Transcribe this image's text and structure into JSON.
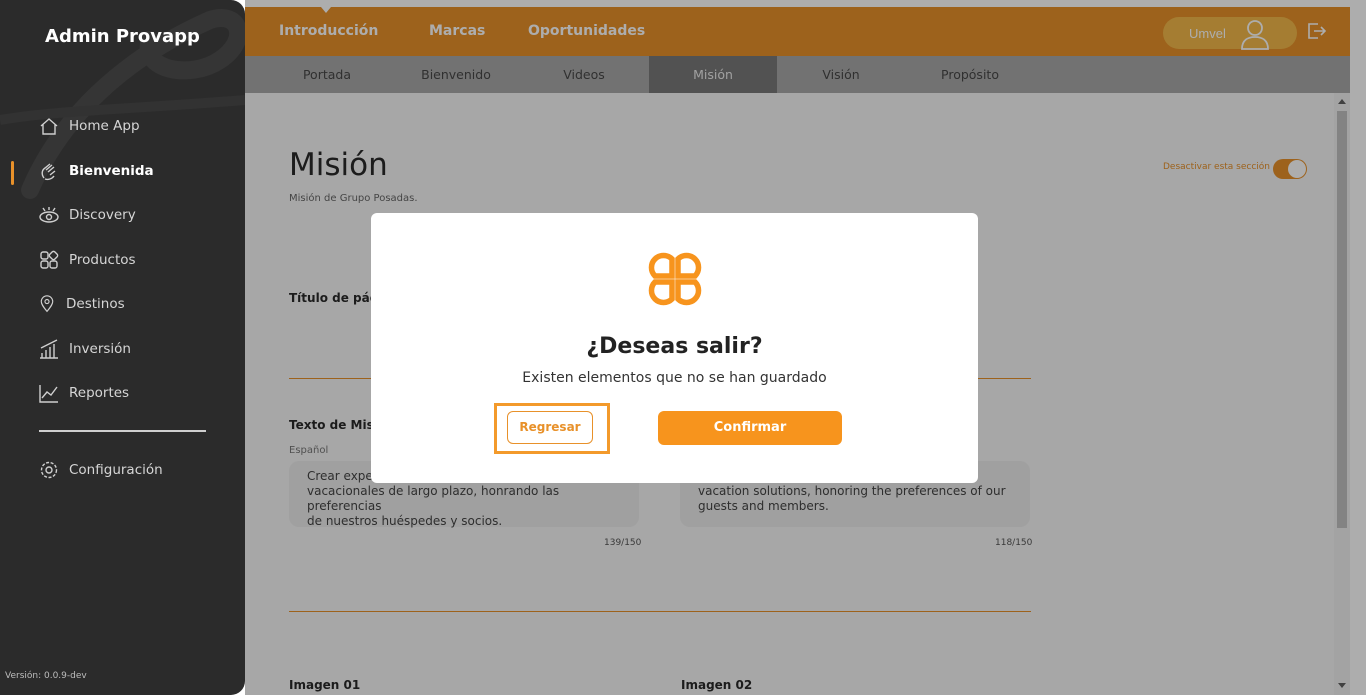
{
  "sidebar": {
    "brand": "Admin Provapp",
    "items": [
      {
        "label": "Home App",
        "icon": "home-icon"
      },
      {
        "label": "Bienvenida",
        "icon": "wave-hand-icon",
        "active": true
      },
      {
        "label": "Discovery",
        "icon": "eye-icon"
      },
      {
        "label": "Productos",
        "icon": "grid-icon"
      },
      {
        "label": "Destinos",
        "icon": "location-pin-icon"
      },
      {
        "label": "Inversión",
        "icon": "bar-chart-icon"
      },
      {
        "label": "Reportes",
        "icon": "line-chart-icon"
      }
    ],
    "settings": {
      "label": "Configuración",
      "icon": "gear-icon"
    },
    "version": "Versión: 0.0.9-dev"
  },
  "topbar": {
    "tabs": [
      "Introducción",
      "Marcas",
      "Oportunidades"
    ],
    "user_name": "Umvel",
    "accent": "#e8912a"
  },
  "subtabs": {
    "items": [
      "Portada",
      "Bienvenido",
      "Videos",
      "Misión",
      "Visión",
      "Propósito"
    ],
    "active": "Misión"
  },
  "main": {
    "title": "Misión",
    "subtitle": "Misión de Grupo Posadas.",
    "toggle_label": "Desactivar esta sección",
    "page_title_label": "Título de pági",
    "mission_text_label": "Texto de Misió",
    "lang_es": "Español",
    "text_es": "Crear exper\nvacacionales de largo plazo, honrando las preferencias\nde nuestros huéspedes y socios.",
    "text_en": "\nvacation solutions, honoring the preferences of our\nguests and members.",
    "count_es": "139/150",
    "count_en": "118/150",
    "image1_label": "Imagen 01",
    "image2_label": "Imagen 02"
  },
  "modal": {
    "title": "¿Deseas salir?",
    "message": "Existen elementos que no se han guardado",
    "back_label": "Regresar",
    "confirm_label": "Confirmar"
  }
}
